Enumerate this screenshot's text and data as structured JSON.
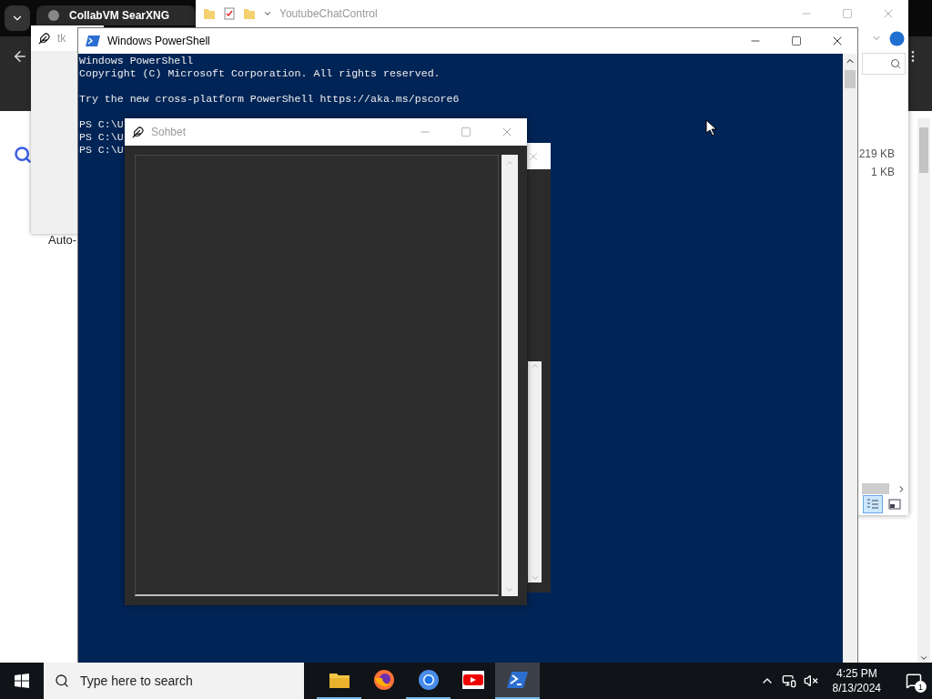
{
  "browser": {
    "tab_title": "CollabVM SearXNG",
    "page_text": "Auto-"
  },
  "explorer": {
    "title": "YoutubeChatControl",
    "sizes": [
      "219 KB",
      "1 KB"
    ],
    "views": [
      {
        "kind": "details",
        "selected": true
      },
      {
        "kind": "preview",
        "selected": false
      }
    ]
  },
  "tk_window": {
    "title": "tk"
  },
  "powershell": {
    "title": "Windows PowerShell",
    "blocks": [
      [
        "Windows PowerShell",
        "Copyright (C) Microsoft Corporation. All rights reserved."
      ],
      [
        "Try the new cross-platform PowerShell https://aka.ms/pscore6"
      ],
      [
        "PS C:\\U",
        "PS C:\\U",
        "PS C:\\U"
      ]
    ]
  },
  "chat_window": {
    "title": "Sohbet"
  },
  "taskbar": {
    "search_placeholder": "Type here to search",
    "apps": [
      {
        "kind": "explorer",
        "running": true,
        "selected": false
      },
      {
        "kind": "firefox",
        "running": false,
        "selected": false
      },
      {
        "kind": "chrome",
        "running": true,
        "selected": false
      },
      {
        "kind": "youtube",
        "running": false,
        "selected": false
      },
      {
        "kind": "powershell",
        "running": true,
        "selected": true
      }
    ],
    "time": "4:25 PM",
    "date": "8/13/2024",
    "notification_count": "1"
  }
}
